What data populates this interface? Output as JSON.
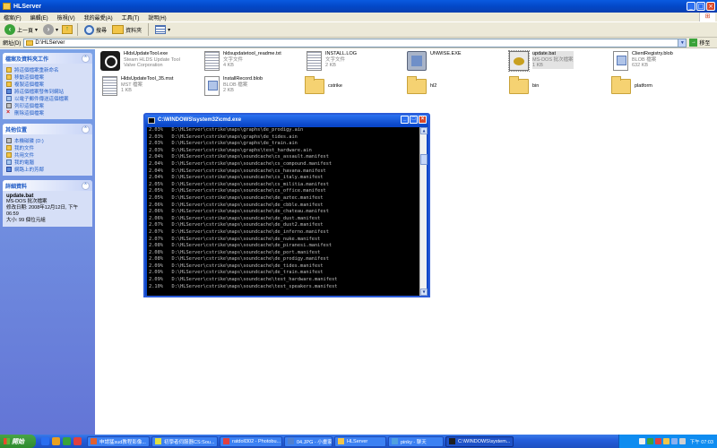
{
  "window": {
    "title": "HLServer"
  },
  "menu": [
    "檔案(F)",
    "編輯(E)",
    "檢視(V)",
    "我的最愛(A)",
    "工具(T)",
    "說明(H)"
  ],
  "toolbar": {
    "back": "上一頁",
    "search": "搜尋",
    "folders": "資料夾"
  },
  "address": {
    "label": "網址(D)",
    "value": "D:\\HLServer",
    "go": "移至"
  },
  "tasks_panel": {
    "title": "檔案及資料夾工作",
    "items": [
      "將這個檔案重新命名",
      "移動這個檔案",
      "複製這個檔案",
      "將這個檔案發佈到網站",
      "以電子郵件傳送這個檔案",
      "列印這個檔案",
      "刪除這個檔案"
    ]
  },
  "places_panel": {
    "title": "其他位置",
    "items": [
      "本機磁碟 (D:)",
      "我的文件",
      "共用文件",
      "我的電腦",
      "網路上的芳鄰"
    ]
  },
  "details_panel": {
    "title": "詳細資料",
    "name": "update.bat",
    "type": "MS-DOS 批次檔案",
    "modified": "修改日期: 2008年12月12日, 下午 06:59",
    "size": "大小: 99 個位元組"
  },
  "files": [
    {
      "name": "HldsUpdateTool.exe",
      "l2": "Steam HLDS Update Tool",
      "l3": "Valve Corporation",
      "icon": "steam"
    },
    {
      "name": "hldsupdatetool_readme.txt",
      "l2": "文字文件",
      "l3": "4 KB",
      "icon": "doc"
    },
    {
      "name": "INSTALL.LOG",
      "l2": "文字文件",
      "l3": "2 KB",
      "icon": "doc"
    },
    {
      "name": "UNWISE.EXE",
      "l2": "",
      "l3": "",
      "icon": "setup"
    },
    {
      "name": "update.bat",
      "l2": "MS-DOS 批次檔案",
      "l3": "1 KB",
      "icon": "bat",
      "selected": true
    },
    {
      "name": "ClientRegistry.blob",
      "l2": "BLOB 檔案",
      "l3": "632 KB",
      "icon": "blob"
    },
    {
      "name": "HldsUpdateTool_35.mst",
      "l2": "MST 檔案",
      "l3": "1 KB",
      "icon": "doc"
    },
    {
      "name": "InstallRecord.blob",
      "l2": "BLOB 檔案",
      "l3": "2 KB",
      "icon": "blob"
    },
    {
      "name": "cstrike",
      "l2": "",
      "l3": "",
      "icon": "folder"
    },
    {
      "name": "hl2",
      "l2": "",
      "l3": "",
      "icon": "folder"
    },
    {
      "name": "bin",
      "l2": "",
      "l3": "",
      "icon": "folder"
    },
    {
      "name": "platform",
      "l2": "",
      "l3": "",
      "icon": "folder"
    }
  ],
  "console": {
    "title": "C:\\WINDOWS\\system32\\cmd.exe",
    "lines": [
      "2.03%   D:\\HLServer\\cstrike\\maps\\graphs\\de_prodigy.ain",
      "2.03%   D:\\HLServer\\cstrike\\maps\\graphs\\de_tides.ain",
      "2.03%   D:\\HLServer\\cstrike\\maps\\graphs\\de_train.ain",
      "2.03%   D:\\HLServer\\cstrike\\maps\\graphs\\test_hardware.ain",
      "2.04%   D:\\HLServer\\cstrike\\maps\\soundcache\\cs_assault.manifest",
      "2.04%   D:\\HLServer\\cstrike\\maps\\soundcache\\cs_compound.manifest",
      "2.04%   D:\\HLServer\\cstrike\\maps\\soundcache\\cs_havana.manifest",
      "2.04%   D:\\HLServer\\cstrike\\maps\\soundcache\\cs_italy.manifest",
      "2.05%   D:\\HLServer\\cstrike\\maps\\soundcache\\cs_militia.manifest",
      "2.05%   D:\\HLServer\\cstrike\\maps\\soundcache\\cs_office.manifest",
      "2.05%   D:\\HLServer\\cstrike\\maps\\soundcache\\de_aztec.manifest",
      "2.06%   D:\\HLServer\\cstrike\\maps\\soundcache\\de_cbble.manifest",
      "2.06%   D:\\HLServer\\cstrike\\maps\\soundcache\\de_chateau.manifest",
      "2.06%   D:\\HLServer\\cstrike\\maps\\soundcache\\de_dust.manifest",
      "2.07%   D:\\HLServer\\cstrike\\maps\\soundcache\\de_dust2.manifest",
      "2.07%   D:\\HLServer\\cstrike\\maps\\soundcache\\de_inferno.manifest",
      "2.07%   D:\\HLServer\\cstrike\\maps\\soundcache\\de_nuke.manifest",
      "2.08%   D:\\HLServer\\cstrike\\maps\\soundcache\\de_piranesi.manifest",
      "2.08%   D:\\HLServer\\cstrike\\maps\\soundcache\\de_port.manifest",
      "2.08%   D:\\HLServer\\cstrike\\maps\\soundcache\\de_prodigy.manifest",
      "2.09%   D:\\HLServer\\cstrike\\maps\\soundcache\\de_tides.manifest",
      "2.09%   D:\\HLServer\\cstrike\\maps\\soundcache\\de_train.manifest",
      "2.09%   D:\\HLServer\\cstrike\\maps\\soundcache\\test_hardware.manifest",
      "2.10%   D:\\HLServer\\cstrike\\maps\\soundcache\\test_speakers.manifest"
    ]
  },
  "taskbar": {
    "start": "開始",
    "items": [
      {
        "label": "申請猛sud教程影像...",
        "color": "#e06030"
      },
      {
        "label": "初學者伺服器CS:Sou...",
        "color": "#e0e040"
      },
      {
        "label": "ratdoll302 - Photobu...",
        "color": "#e04040"
      },
      {
        "label": "04.JPG - 小畫家",
        "color": "#5080d0"
      },
      {
        "label": "HLServer",
        "color": "#f2c548"
      },
      {
        "label": "pinky - 聊天",
        "color": "#50a0e0"
      },
      {
        "label": "C:\\WINDOWS\\system...",
        "color": "#202020",
        "active": true
      }
    ],
    "clock": "下午 07:03"
  }
}
